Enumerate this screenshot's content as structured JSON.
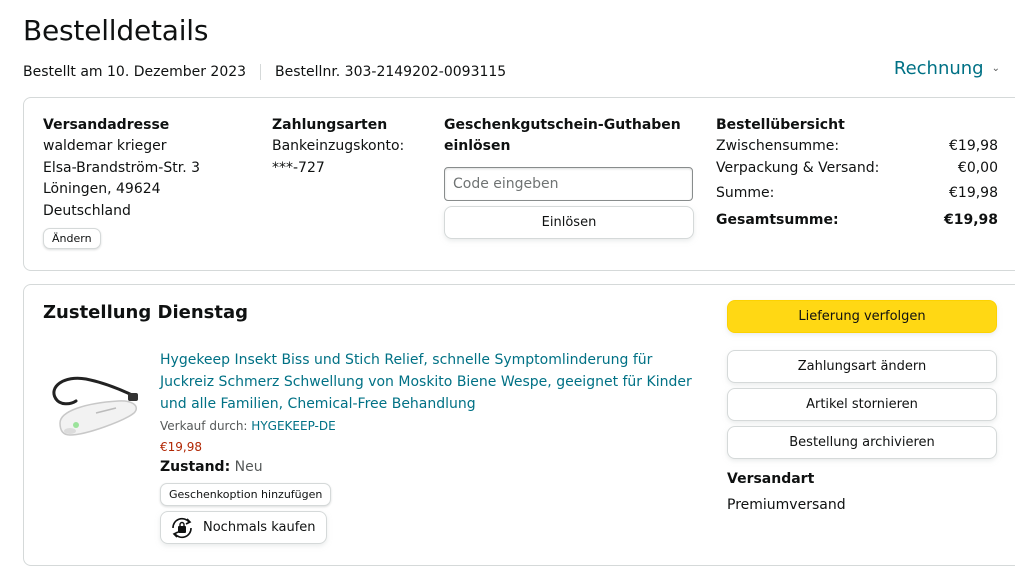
{
  "header": {
    "title": "Bestelldetails",
    "ordered_on": "Bestellt am 10. Dezember 2023",
    "order_number": "Bestellnr. 303-2149202-0093115",
    "invoice_label": "Rechnung"
  },
  "shipping_address": {
    "heading": "Versandadresse",
    "name": "waldemar krieger",
    "street": "Elsa-Brandström-Str. 3",
    "city": "Löningen, 49624",
    "country": "Deutschland",
    "change_label": "Ändern"
  },
  "payment": {
    "heading": "Zahlungsarten",
    "method": "Bankeinzugskonto:",
    "account": "***-727"
  },
  "gift_card": {
    "heading": "Geschenkgutschein-Guthaben einlösen",
    "placeholder": "Code eingeben",
    "value": "",
    "redeem_label": "Einlösen"
  },
  "order_summary": {
    "heading": "Bestellübersicht",
    "rows": [
      {
        "label": "Zwischensumme:",
        "value": "€19,98"
      },
      {
        "label": "Verpackung & Versand:",
        "value": "€0,00"
      },
      {
        "label": "Summe:",
        "value": "€19,98"
      }
    ],
    "total_label": "Gesamtsumme:",
    "total_value": "€19,98"
  },
  "delivery": {
    "title": "Zustellung Dienstag",
    "product": {
      "title": "Hygekeep Insekt Biss und Stich Relief, schnelle Symptomlinderung für Juckreiz Schmerz Schwellung von Moskito Biene Wespe, geeignet für Kinder und alle Familien, Chemical-Free Behandlung",
      "sold_by_label": "Verkauf durch:",
      "seller": "HYGEKEEP-DE",
      "price": "€19,98",
      "condition_label": "Zustand:",
      "condition_value": "Neu",
      "gift_option_label": "Geschenkoption hinzufügen",
      "buy_again_label": "Nochmals kaufen"
    },
    "actions": {
      "track": "Lieferung verfolgen",
      "change_payment": "Zahlungsart ändern",
      "cancel_items": "Artikel stornieren",
      "archive": "Bestellung archivieren"
    },
    "shipping_method_heading": "Versandart",
    "shipping_method": "Premiumversand"
  },
  "colors": {
    "link": "#007185",
    "price": "#b12704",
    "primary_button": "#ffd814",
    "border": "#d5d9d9"
  }
}
